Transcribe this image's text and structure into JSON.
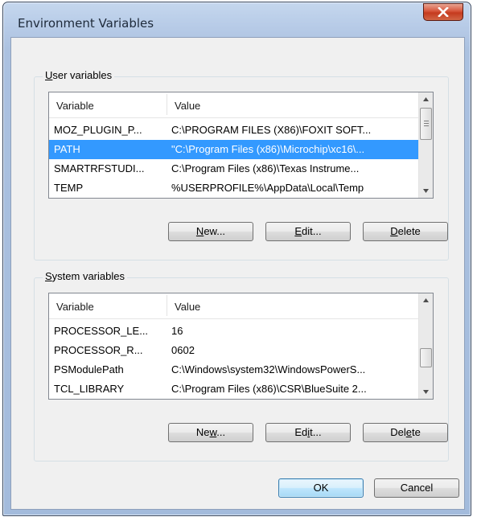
{
  "window": {
    "title": "Environment Variables",
    "close_symbol": "✕"
  },
  "user_variables": {
    "legend_access": "U",
    "legend_rest": "ser variables",
    "columns": [
      "Variable",
      "Value"
    ],
    "rows": [
      {
        "variable": "MOZ_PLUGIN_P...",
        "value": "C:\\PROGRAM FILES (X86)\\FOXIT SOFT...",
        "selected": false
      },
      {
        "variable": "PATH",
        "value": "\"C:\\Program Files (x86)\\Microchip\\xc16\\...",
        "selected": true
      },
      {
        "variable": "SMARTRFSTUDI...",
        "value": "C:\\Program Files (x86)\\Texas Instrume...",
        "selected": false
      },
      {
        "variable": "TEMP",
        "value": "%USERPROFILE%\\AppData\\Local\\Temp",
        "selected": false
      }
    ],
    "buttons": {
      "new_access": "N",
      "new_rest": "ew...",
      "edit_access": "E",
      "edit_rest": "dit...",
      "delete_access": "D",
      "delete_rest": "elete"
    }
  },
  "system_variables": {
    "legend_access": "S",
    "legend_rest": "ystem variables",
    "columns": [
      "Variable",
      "Value"
    ],
    "rows": [
      {
        "variable": "PROCESSOR_LE...",
        "value": "16"
      },
      {
        "variable": "PROCESSOR_R...",
        "value": "0602"
      },
      {
        "variable": "PSModulePath",
        "value": "C:\\Windows\\system32\\WindowsPowerS..."
      },
      {
        "variable": "TCL_LIBRARY",
        "value": "C:\\Program Files (x86)\\CSR\\BlueSuite 2..."
      }
    ],
    "buttons": {
      "new_pre": "Ne",
      "new_access": "w",
      "new_post": "...",
      "edit_pre": "Ed",
      "edit_access": "i",
      "edit_post": "t...",
      "delete_pre": "Del",
      "delete_access": "e",
      "delete_post": "te"
    }
  },
  "dialog_buttons": {
    "ok": "OK",
    "cancel": "Cancel"
  }
}
